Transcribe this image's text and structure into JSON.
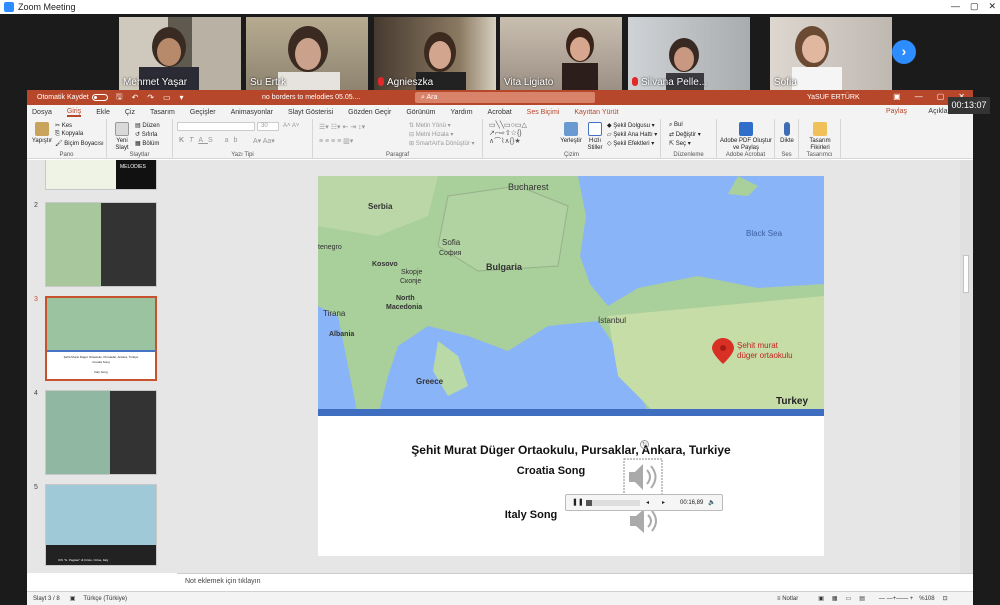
{
  "window": {
    "title": "Zoom Meeting"
  },
  "participants": [
    {
      "name": "Mehmet Yaşar",
      "muted": false
    },
    {
      "name": "Su Ertrk",
      "muted": false
    },
    {
      "name": "Agnieszka",
      "muted": true
    },
    {
      "name": "Vita Ligiato",
      "muted": false
    },
    {
      "name": "Silvana Pelle...",
      "muted": true
    },
    {
      "name": "Sofia",
      "muted": false
    }
  ],
  "meeting_timer": "00:13:07",
  "ppt": {
    "autosave_label": "Otomatik Kaydet",
    "doc_title": "no borders to melodies 05.05....",
    "search_placeholder": "Ara",
    "user_name": "YaSUF ERTÜRK",
    "tabs": [
      "Dosya",
      "Giriş",
      "Ekle",
      "Çiz",
      "Tasarım",
      "Geçişler",
      "Animasyonlar",
      "Slayt Gösterisi",
      "Gözden Geçir",
      "Görünüm",
      "Yardım",
      "Acrobat",
      "Ses Biçimi",
      "Kayıttan Yürüt"
    ],
    "active_tab": "Giriş",
    "share_label": "Paylaş",
    "comments_label": "Açıklamalar",
    "ribbon": {
      "paste": "Yapıştır",
      "cut": "Kes",
      "copy": "Kopyala",
      "format_painter": "Biçim Boyacısı",
      "clipboard": "Pano",
      "new_slide": "Yeni Slayt",
      "layout": "Düzen",
      "reset": "Sıfırla",
      "section": "Bölüm",
      "slides": "Slaytlar",
      "font_size": "30",
      "font": "Yazı Tipi",
      "paragraph": "Paragraf",
      "text_direction": "Metin Yönü",
      "align_text": "Metni Hizala",
      "smartart": "SmartArt'a Dönüştür",
      "arrange": "Yerleştir",
      "quick_styles": "Hızlı Stiller",
      "shape_fill": "Şekil Dolgusu",
      "shape_outline": "Şekil Ana Hattı",
      "shape_effects": "Şekil Efektleri",
      "drawing": "Çizim",
      "find": "Bul",
      "replace": "Değiştir",
      "select": "Seç",
      "editing": "Düzenleme",
      "adobe_create": "Adobe PDF Oluştur ve Paylaş",
      "adobe": "Adobe Acrobat",
      "dictate": "Dikte",
      "voice": "Ses",
      "designer": "Tasarım Fikirleri",
      "designer_grp": "Tasarımcı"
    },
    "slide_numbers": [
      "2",
      "3",
      "4",
      "5"
    ],
    "thumb3_lines": [
      "Şehit Murat Düger Ortaokulu, Pursaklar, Ankara, Turkiye",
      "Croatia Song",
      "Italy Song"
    ],
    "thumb5_caption": "ICS \"G. Pagiato\" di Crisio, Cirisa, Italy",
    "thumb1_caption": "MELODIES",
    "map_labels": {
      "bucharest": "Bucharest",
      "serbia": "Serbia",
      "black_sea": "Black Sea",
      "montenegro": "tenegro",
      "sofia": "Sofia",
      "sofia_cyr": "София",
      "kosovo": "Kosovo",
      "bulgaria": "Bulgaria",
      "skopje": "Skopje",
      "skopje_cyr": "Скопје",
      "north": "North",
      "macedonia": "Macedonia",
      "istanbul": "İstanbul",
      "tirana": "Tirana",
      "albania": "Albania",
      "greece": "Greece",
      "turkey": "Turkey",
      "pin_line1": "Şehit murat",
      "pin_line2": "düger ortaokulu"
    },
    "slide_title": "Şehit Murat Düger Ortaokulu, Pursaklar, Ankara, Turkiye",
    "song1": "Croatia Song",
    "song2": "Italy Song",
    "player_time": "00:16,89",
    "player_progress": 0.12,
    "notes_placeholder": "Not eklemek için tıklayın",
    "status_slide": "Slayt 3 / 8",
    "status_lang": "Türkçe (Türkiye)",
    "status_notes": "Notlar",
    "status_zoom": "%108"
  },
  "colors": {
    "ppt_accent": "#b7472a",
    "zoom_blue": "#2d8cff"
  }
}
